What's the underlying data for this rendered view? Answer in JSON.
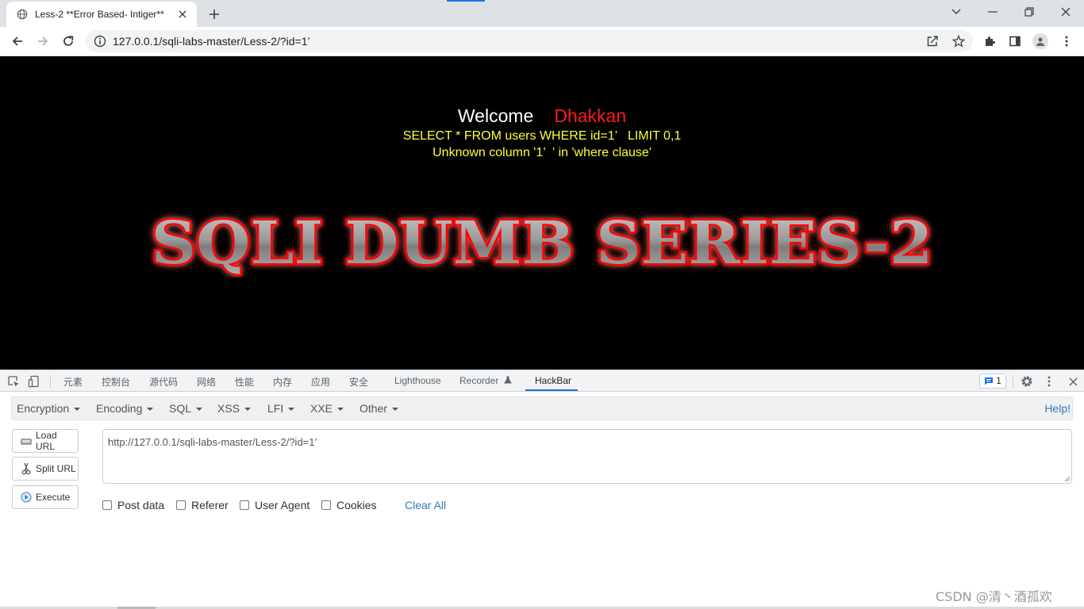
{
  "browser": {
    "tab_title": "Less-2 **Error Based- Intiger**",
    "url": "127.0.0.1/sqli-labs-master/Less-2/?id=1’"
  },
  "page": {
    "welcome": "Welcome",
    "user": "Dhakkan",
    "query": "SELECT * FROM users WHERE id=1’   LIMIT 0,1",
    "error": "Unknown column '1’  ' in 'where clause'",
    "banner": "SQLI DUMB SERIES-2",
    "colors": {
      "welcome": "#ffffff",
      "user": "#ff1a1a",
      "sql_text": "#ffff33",
      "banner_glow": "#ff0000"
    }
  },
  "devtools": {
    "tabs": [
      "元素",
      "控制台",
      "源代码",
      "网络",
      "性能",
      "内存",
      "应用",
      "安全",
      "Lighthouse",
      "Recorder",
      "HackBar"
    ],
    "active_tab": "HackBar",
    "message_count": "1"
  },
  "hackbar": {
    "menu": [
      "Encryption",
      "Encoding",
      "SQL",
      "XSS",
      "LFI",
      "XXE",
      "Other"
    ],
    "help": "Help!",
    "buttons": {
      "load": "Load URL",
      "split": "Split URL",
      "execute": "Execute"
    },
    "url_value": "http://127.0.0.1/sqli-labs-master/Less-2/?id=1’",
    "checks": [
      "Post data",
      "Referer",
      "User Agent",
      "Cookies"
    ],
    "clear_all": "Clear All"
  },
  "watermark": "CSDN @清丶酒孤欢"
}
